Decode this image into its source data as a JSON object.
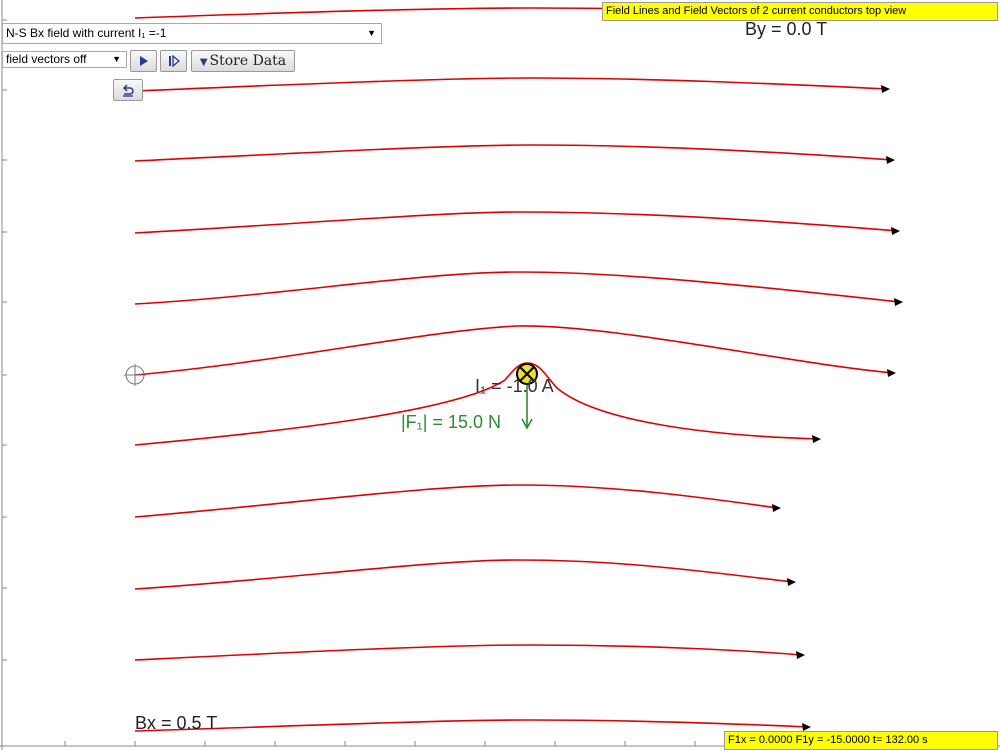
{
  "title_banner": "Field Lines and Field Vectors of 2 current conductors top view",
  "field_select": {
    "selected": "N-S Bx field with current I₁ =-1"
  },
  "vector_select": {
    "selected": "field vectors off"
  },
  "buttons": {
    "play_icon": "play-icon",
    "step_icon": "step-icon",
    "store_label": "Store Data",
    "reset_icon": "reset-icon"
  },
  "labels": {
    "by": "By = 0.0 T",
    "bx": "Bx = 0.5 T",
    "current": "I₁ = -1.0 A",
    "force": "|F₁| = 15.0 N"
  },
  "status": "F1x = 0.0000 F1y = -15.0000 t= 132.00 s",
  "colors": {
    "field_line": "#e00000",
    "force_vector": "#2e8b2e",
    "conductor_fill": "#f0e020",
    "highlight": "#ffff00"
  }
}
